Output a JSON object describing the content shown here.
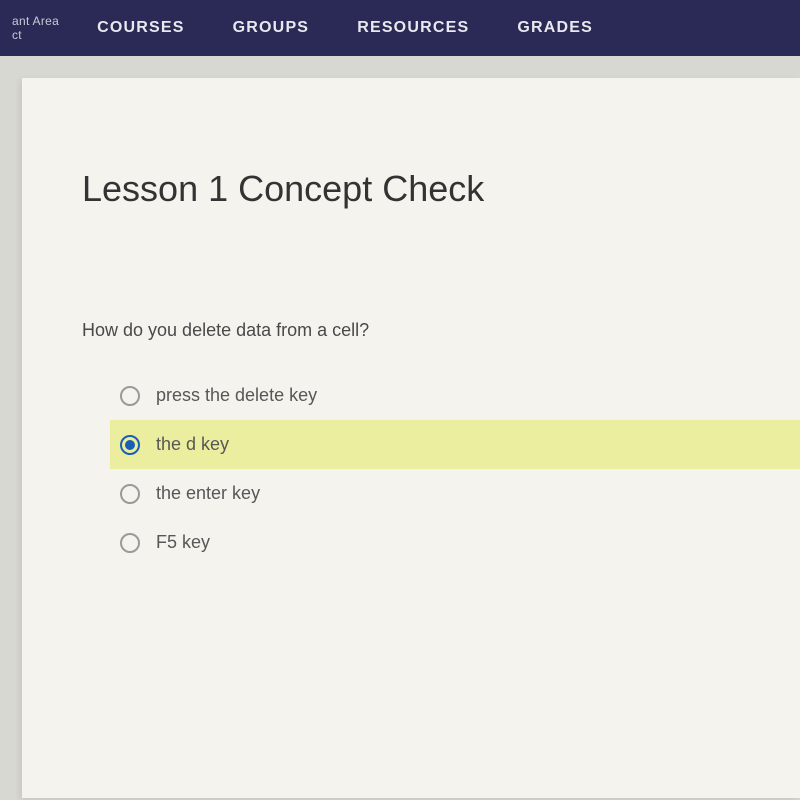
{
  "brand": {
    "line1": "ant Area",
    "line2": "ct"
  },
  "nav": {
    "items": [
      "COURSES",
      "GROUPS",
      "RESOURCES",
      "GRADES"
    ]
  },
  "page": {
    "title": "Lesson 1 Concept Check"
  },
  "question": {
    "prompt": "How do you delete data from a cell?",
    "options": [
      {
        "label": "press the delete key",
        "selected": false
      },
      {
        "label": "the d key",
        "selected": true
      },
      {
        "label": "the enter key",
        "selected": false
      },
      {
        "label": "F5 key",
        "selected": false
      }
    ]
  }
}
